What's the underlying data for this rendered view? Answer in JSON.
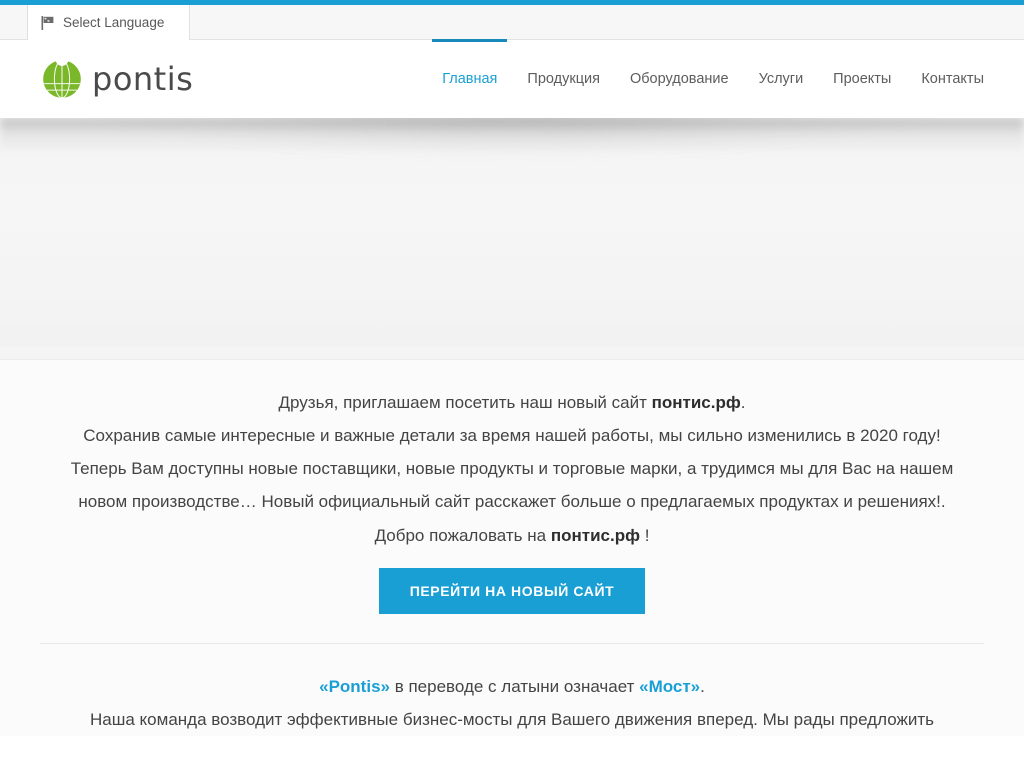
{
  "theme": {
    "accent_blue": "#1a9fd4",
    "accent_blue_dark": "#1789bb",
    "logo_green": "#76b828",
    "text_gray": "#444444",
    "strip_gray": "#f7f7f7",
    "hero_gray": "#f4f4f4"
  },
  "translate_bar": {
    "icon": "flag-icon",
    "label": "Select Language"
  },
  "header": {
    "logo_icon": "pontis-globe-logo",
    "brand": "pontis",
    "nav": [
      {
        "label": "Главная",
        "active": true
      },
      {
        "label": "Продукция",
        "active": false
      },
      {
        "label": "Оборудование",
        "active": false
      },
      {
        "label": "Услуги",
        "active": false
      },
      {
        "label": "Проекты",
        "active": false
      },
      {
        "label": "Контакты",
        "active": false
      }
    ]
  },
  "hero": {
    "state": "empty-slider-placeholder"
  },
  "promo": {
    "line1_pre": "Друзья, приглашаем посетить наш новый сайт ",
    "line1_bold": "понтис.рф",
    "line1_post": ".",
    "line2": "Сохранив самые интересные и важные детали за время нашей работы, мы сильно изменились в 2020 году!",
    "line3": "Теперь Вам доступны новые поставщики, новые продукты и торговые марки, а трудимся мы для Вас на нашем",
    "line4": "новом производстве… Новый официальный сайт расскажет больше о предлагаемых продуктах и решениях!.",
    "line5_pre": "Добро пожаловать на ",
    "line5_bold": "понтис.рф",
    "line5_post": " !",
    "cta_label": "ПЕРЕЙТИ НА НОВЫЙ САЙТ"
  },
  "about": {
    "line1_a": "«Pontis»",
    "line1_b": " в переводе с латыни означает ",
    "line1_c": "«Мост»",
    "line1_d": ".",
    "line2": "Наша команда возводит эффективные бизнес-мосты для Вашего движения вперед. Мы рады предложить"
  }
}
